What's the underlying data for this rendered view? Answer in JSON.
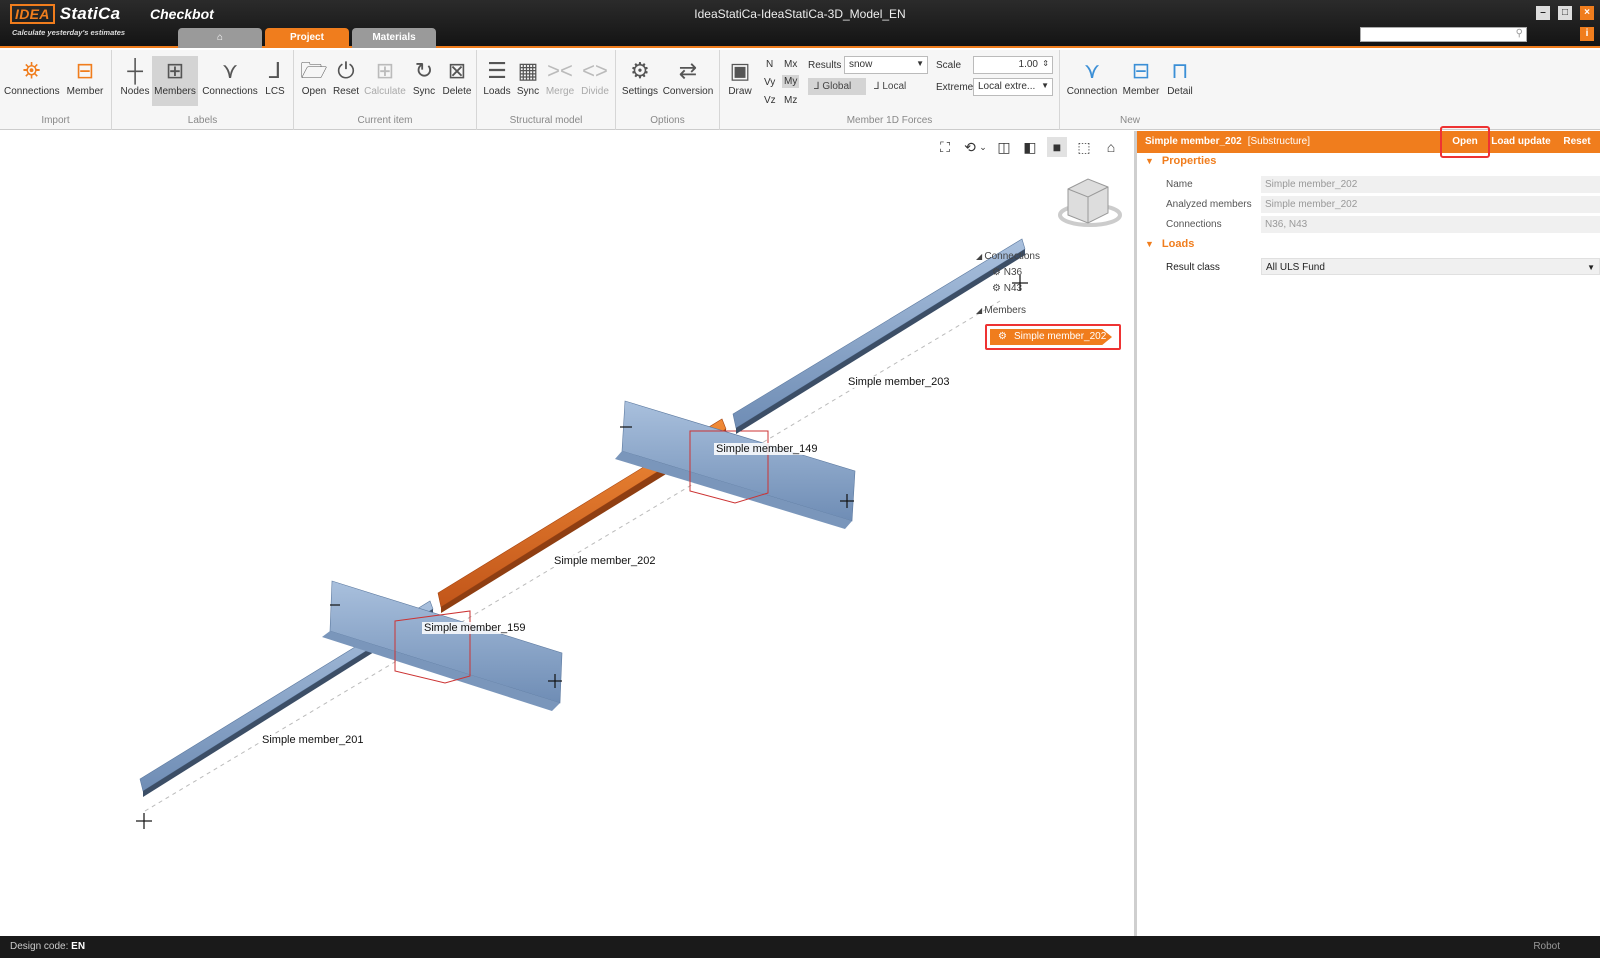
{
  "app": {
    "logo": "IDEA StatiCa",
    "logo_idea": "IDEA",
    "logo_rest": "StatiCa",
    "tagline": "Calculate yesterday's estimates",
    "name": "Checkbot",
    "window_title": "IdeaStatiCa-IdeaStatiCa-3D_Model_EN"
  },
  "tabs": [
    {
      "label": "Project"
    },
    {
      "label": "Materials"
    }
  ],
  "ribbon": {
    "import": {
      "label": "Import",
      "connections": "Connections",
      "member": "Member"
    },
    "labels": {
      "label": "Labels",
      "nodes": "Nodes",
      "members": "Members",
      "connections": "Connections",
      "lcs": "LCS"
    },
    "current_item": {
      "label": "Current item",
      "open": "Open",
      "reset": "Reset",
      "calculate": "Calculate",
      "sync": "Sync",
      "delete": "Delete"
    },
    "structural_model": {
      "label": "Structural model",
      "loads": "Loads",
      "sync": "Sync",
      "merge": "Merge",
      "divide": "Divide"
    },
    "options": {
      "label": "Options",
      "settings": "Settings",
      "conversion": "Conversion"
    },
    "forces": {
      "label": "Member 1D Forces",
      "draw": "Draw",
      "n": "N",
      "vy": "Vy",
      "vz": "Vz",
      "mx": "Mx",
      "my": "My",
      "mz": "Mz",
      "results_label": "Results",
      "results_value": "snow",
      "global": "Global",
      "local": "Local",
      "scale_label": "Scale",
      "scale_value": "1.00",
      "extreme_label": "Extreme",
      "extreme_value": "Local extre..."
    },
    "new": {
      "label": "New",
      "connection": "Connection",
      "member": "Member",
      "detail": "Detail"
    }
  },
  "viewport": {
    "member_labels": {
      "m203": "Simple member_203",
      "m149": "Simple member_149",
      "m202": "Simple member_202",
      "m159": "Simple member_159",
      "m201": "Simple member_201"
    },
    "tree": {
      "connections_header": "Connections",
      "n36": "N36",
      "n43": "N43",
      "members_header": "Members",
      "selected_member": "Simple member_202"
    }
  },
  "panel": {
    "header_title": "Simple member_202",
    "header_sub": "[Substructure]",
    "open": "Open",
    "load_update": "Load update",
    "reset": "Reset",
    "properties": {
      "title": "Properties",
      "name_label": "Name",
      "name_value": "Simple member_202",
      "analyzed_label": "Analyzed members",
      "analyzed_value": "Simple member_202",
      "connections_label": "Connections",
      "connections_value": "N36, N43"
    },
    "loads": {
      "title": "Loads",
      "result_class_label": "Result class",
      "result_class_value": "All ULS Fund"
    }
  },
  "status": {
    "design_code_label": "Design code:",
    "design_code_value": "EN",
    "right": "Robot"
  },
  "colors": {
    "accent": "#f07d1d",
    "steel": "#8fa8c8",
    "highlight": "#e33333"
  }
}
